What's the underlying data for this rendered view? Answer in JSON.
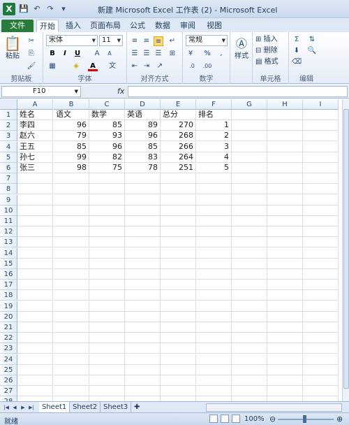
{
  "window": {
    "title": "新建 Microsoft Excel 工作表 (2) - Microsoft Excel",
    "logo": "X"
  },
  "ribbon_tabs": [
    "文件",
    "开始",
    "插入",
    "页面布局",
    "公式",
    "数据",
    "审阅",
    "视图"
  ],
  "ribbon": {
    "clipboard": {
      "label": "剪贴板",
      "paste": "粘贴"
    },
    "font": {
      "label": "字体",
      "font_name": "宋体",
      "font_size": "11"
    },
    "alignment": {
      "label": "对齐方式"
    },
    "number": {
      "label": "数字",
      "format": "常规"
    },
    "styles": {
      "button": "样式"
    },
    "cells": {
      "label": "单元格",
      "insert": "插入",
      "delete": "删除",
      "format": "格式"
    },
    "editing": {
      "label": "编辑"
    }
  },
  "formula_bar": {
    "name_box": "F10",
    "fx": "fx",
    "content": ""
  },
  "columns": [
    "A",
    "B",
    "C",
    "D",
    "E",
    "F",
    "G",
    "H",
    "I"
  ],
  "rows": [
    "1",
    "2",
    "3",
    "4",
    "5",
    "6",
    "7",
    "8",
    "9",
    "10",
    "11",
    "12",
    "13",
    "14",
    "15",
    "16",
    "17",
    "18",
    "19",
    "20",
    "21",
    "22",
    "23",
    "24",
    "25",
    "26",
    "27",
    "28"
  ],
  "table": {
    "headers": [
      "姓名",
      "语文",
      "数学",
      "英语",
      "总分",
      "排名"
    ],
    "rows": [
      [
        "李四",
        "96",
        "85",
        "89",
        "270",
        "1"
      ],
      [
        "赵六",
        "79",
        "93",
        "96",
        "268",
        "2"
      ],
      [
        "王五",
        "85",
        "96",
        "85",
        "266",
        "3"
      ],
      [
        "孙七",
        "99",
        "82",
        "83",
        "264",
        "4"
      ],
      [
        "张三",
        "98",
        "75",
        "78",
        "251",
        "5"
      ]
    ]
  },
  "sheets": [
    "Sheet1",
    "Sheet2",
    "Sheet3"
  ],
  "status": {
    "ready": "就绪",
    "zoom": "100%"
  }
}
